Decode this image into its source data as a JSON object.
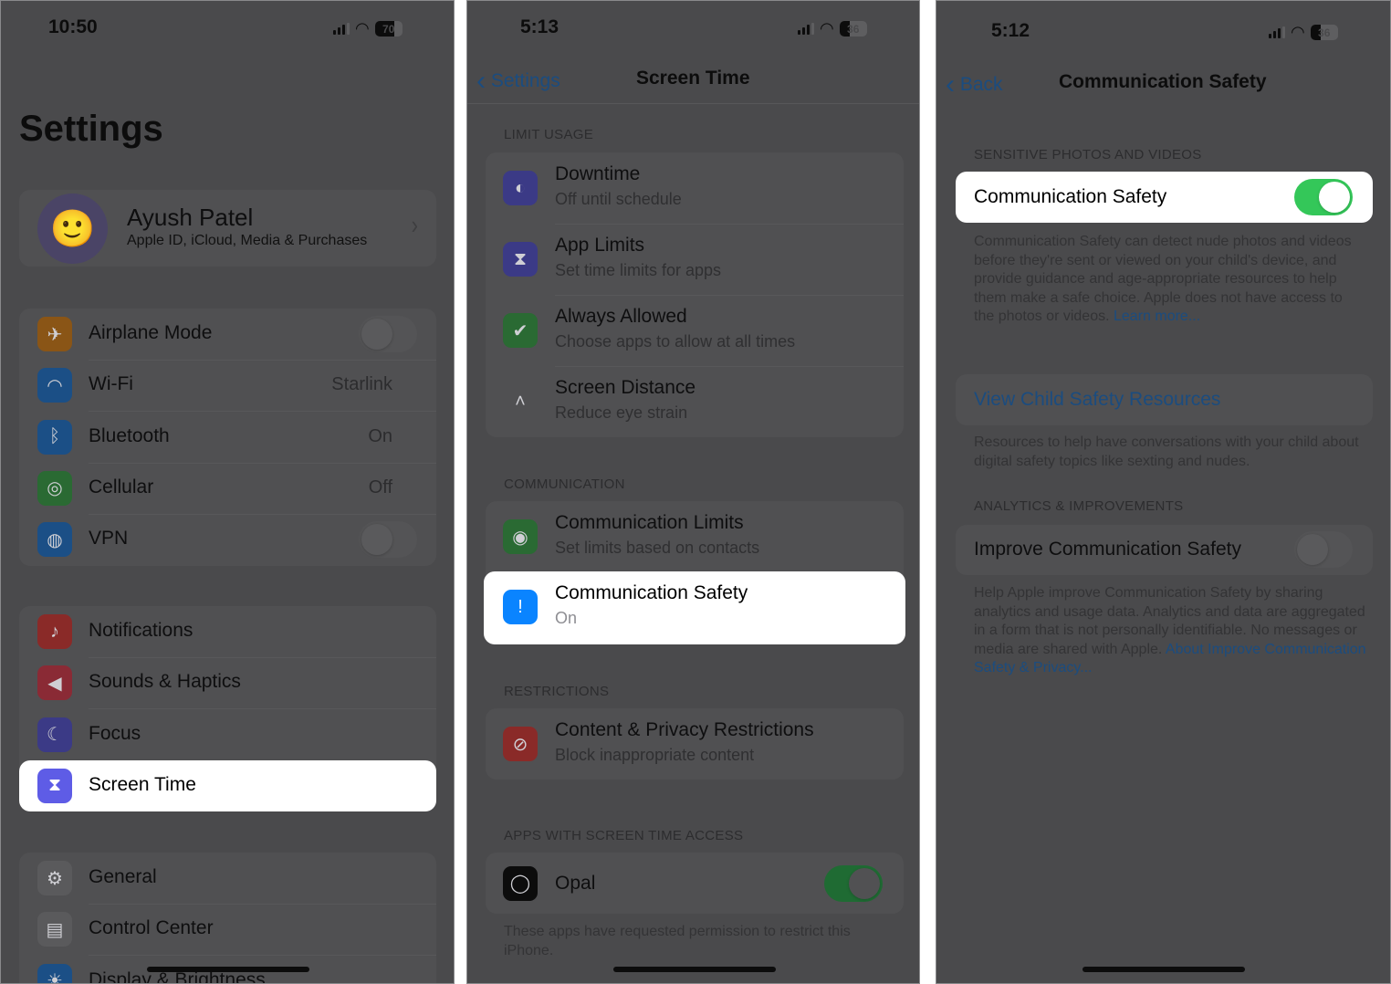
{
  "panels": [
    {
      "status": {
        "time": "10:50",
        "battery": "70",
        "battery_level": 70
      },
      "title": "Settings",
      "profile": {
        "name": "Ayush Patel",
        "subtitle": "Apple ID, iCloud, Media & Purchases"
      },
      "groups": [
        [
          {
            "label": "Airplane Mode",
            "icon": "airplane-icon",
            "toggle": false
          },
          {
            "label": "Wi-Fi",
            "icon": "wifi-icon",
            "value": "Starlink"
          },
          {
            "label": "Bluetooth",
            "icon": "bluetooth-icon",
            "value": "On"
          },
          {
            "label": "Cellular",
            "icon": "cellular-icon",
            "value": "Off"
          },
          {
            "label": "VPN",
            "icon": "vpn-globe-icon",
            "toggle": false
          }
        ],
        [
          {
            "label": "Notifications",
            "icon": "bell-icon"
          },
          {
            "label": "Sounds & Haptics",
            "icon": "speaker-icon"
          },
          {
            "label": "Focus",
            "icon": "moon-icon"
          },
          {
            "label": "Screen Time",
            "icon": "hourglass-icon",
            "highlighted": true
          }
        ],
        [
          {
            "label": "General",
            "icon": "gear-icon"
          },
          {
            "label": "Control Center",
            "icon": "toggles-icon"
          },
          {
            "label": "Display & Brightness",
            "icon": "sun-icon"
          }
        ]
      ]
    },
    {
      "status": {
        "time": "5:13",
        "battery": "36",
        "battery_level": 36
      },
      "nav": {
        "back": "Settings",
        "title": "Screen Time"
      },
      "sections": [
        {
          "header": "LIMIT USAGE",
          "rows": [
            {
              "label": "Downtime",
              "sub": "Off until schedule",
              "icon": "downtime-icon"
            },
            {
              "label": "App Limits",
              "sub": "Set time limits for apps",
              "icon": "hourglass-icon"
            },
            {
              "label": "Always Allowed",
              "sub": "Choose apps to allow at all times",
              "icon": "checkmark-shield-icon"
            },
            {
              "label": "Screen Distance",
              "sub": "Reduce eye strain",
              "icon": "screen-distance-icon"
            }
          ]
        },
        {
          "header": "COMMUNICATION",
          "rows": [
            {
              "label": "Communication Limits",
              "sub": "Set limits based on contacts",
              "icon": "person-circle-icon"
            },
            {
              "label": "Communication Safety",
              "sub": "On",
              "icon": "message-alert-icon",
              "highlighted": true
            }
          ]
        },
        {
          "header": "RESTRICTIONS",
          "rows": [
            {
              "label": "Content & Privacy Restrictions",
              "sub": "Block inappropriate content",
              "icon": "prohibited-icon"
            }
          ]
        },
        {
          "header": "APPS WITH SCREEN TIME ACCESS",
          "rows": [
            {
              "label": "Opal",
              "icon": "opal-app-icon",
              "toggle": true
            }
          ],
          "footer": "These apps have requested permission to restrict this iPhone."
        }
      ]
    },
    {
      "status": {
        "time": "5:12",
        "battery": "36",
        "battery_level": 36
      },
      "nav": {
        "back": "Back",
        "title": "Communication Safety"
      },
      "section1": {
        "header": "SENSITIVE PHOTOS AND VIDEOS",
        "row": {
          "label": "Communication Safety",
          "toggle": true
        },
        "footer": "Communication Safety can detect nude photos and videos before they're sent or viewed on your child's device, and provide guidance and age-appropriate resources to help them make a safe choice. Apple does not have access to the photos or videos.",
        "footer_link": "Learn more..."
      },
      "resources": {
        "link": "View Child Safety Resources",
        "footer": "Resources to help have conversations with your child about digital safety topics like sexting and nudes."
      },
      "section2": {
        "header": "ANALYTICS & IMPROVEMENTS",
        "row": {
          "label": "Improve Communication Safety",
          "toggle": false
        },
        "footer": "Help Apple improve Communication Safety by sharing analytics and usage data. Analytics and data are aggregated in a form that is not personally identifiable. No messages or media are shared with Apple.",
        "footer_link": "About Improve Communication Safety & Privacy..."
      }
    }
  ],
  "colors": {
    "accent_blue": "#0a84ff",
    "toggle_green": "#34c759",
    "screen_time_purple": "#5e5ce6",
    "dim_overlay": "#4a4a4c"
  }
}
